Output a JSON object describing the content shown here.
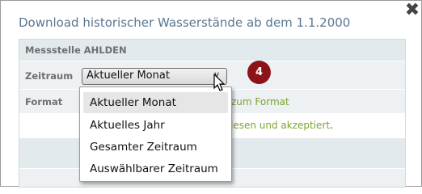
{
  "dialog": {
    "title": "Download historischer Wasserstände ab dem 1.1.2000",
    "close_icon": "close-icon"
  },
  "table": {
    "header_label": "Messstelle AHLDEN",
    "zeitraum_label": "Zeitraum",
    "zeitraum_selected": "Aktueller Monat",
    "format_label": "Format",
    "format_link_text": "zum Format",
    "accept_link_text": "lesen und akzeptiert",
    "accept_suffix": "."
  },
  "dropdown": {
    "options": [
      {
        "label": "Aktueller Monat",
        "selected": true
      },
      {
        "label": "Aktuelles Jahr",
        "selected": false
      },
      {
        "label": "Gesamter Zeitraum",
        "selected": false
      },
      {
        "label": "Auswählbarer Zeitraum",
        "selected": false
      }
    ]
  },
  "annotation": {
    "step_number": "4",
    "color": "#8c1418"
  },
  "colors": {
    "title": "#5a7792",
    "link": "#7aa52b",
    "table_bg": "#edf1f3"
  }
}
